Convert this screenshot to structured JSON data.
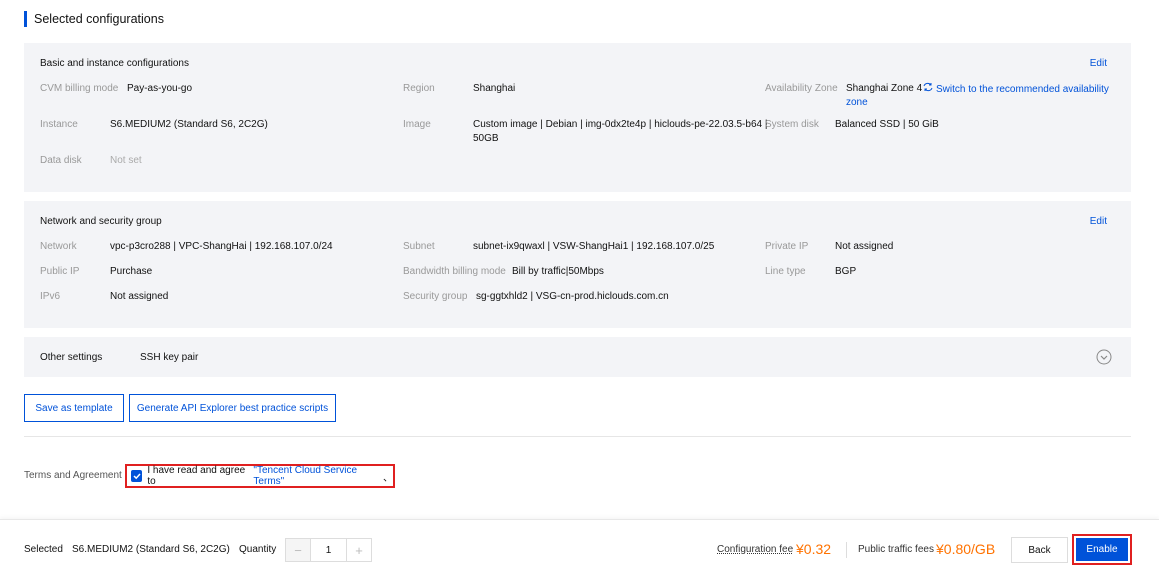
{
  "page_title": "Selected configurations",
  "basic": {
    "title": "Basic and instance configurations",
    "edit": "Edit",
    "billing_label": "CVM billing mode",
    "billing_value": "Pay-as-you-go",
    "region_label": "Region",
    "region_value": "Shanghai",
    "az_label": "Availability Zone",
    "az_value": "Shanghai Zone 4",
    "az_switch_a": "Switch to the recommended availability",
    "az_switch_b": "zone",
    "instance_label": "Instance",
    "instance_value": "S6.MEDIUM2 (Standard S6, 2C2G)",
    "image_label": "Image",
    "image_value_a": "Custom image | Debian | img-0dx2te4p | hiclouds-pe-22.03.5-b64 |",
    "image_value_b": "50GB",
    "sysdisk_label": "System disk",
    "sysdisk_value": "Balanced SSD | 50 GiB",
    "datadisk_label": "Data disk",
    "datadisk_value": "Not set"
  },
  "network": {
    "title": "Network and security group",
    "edit": "Edit",
    "network_label": "Network",
    "network_value": "vpc-p3cro288 | VPC-ShangHai | 192.168.107.0/24",
    "subnet_label": "Subnet",
    "subnet_value": "subnet-ix9qwaxl | VSW-ShangHai1 | 192.168.107.0/25",
    "privip_label": "Private IP",
    "privip_value": "Not assigned",
    "pubip_label": "Public IP",
    "pubip_value": "Purchase",
    "bw_label": "Bandwidth billing mode",
    "bw_value": "Bill by traffic|50Mbps",
    "line_label": "Line type",
    "line_value": "BGP",
    "ipv6_label": "IPv6",
    "ipv6_value": "Not assigned",
    "sg_label": "Security group",
    "sg_value": "sg-ggtxhld2 | VSG-cn-prod.hiclouds.com.cn"
  },
  "other": {
    "label": "Other settings",
    "value": "SSH key pair"
  },
  "actions": {
    "save_template": "Save as template",
    "generate_api": "Generate API Explorer best practice scripts"
  },
  "terms": {
    "label": "Terms and Agreement",
    "text": "I have read and agree to",
    "link": "\"Tencent Cloud Service Terms\"",
    "trail": "、"
  },
  "footer": {
    "selected_label": "Selected",
    "selected_value": "S6.MEDIUM2 (Standard S6, 2C2G)",
    "quantity_label": "Quantity",
    "quantity_value": "1",
    "minus": "−",
    "plus": "+",
    "config_fee_label": "Configuration fee",
    "config_fee_value": "¥0.32",
    "traffic_fee_label": "Public traffic fees",
    "traffic_fee_value": "¥0.80/GB",
    "back": "Back",
    "enable": "Enable"
  },
  "colors": {
    "accent": "#0052d9",
    "price": "#ff7200",
    "highlight": "#e02020"
  }
}
